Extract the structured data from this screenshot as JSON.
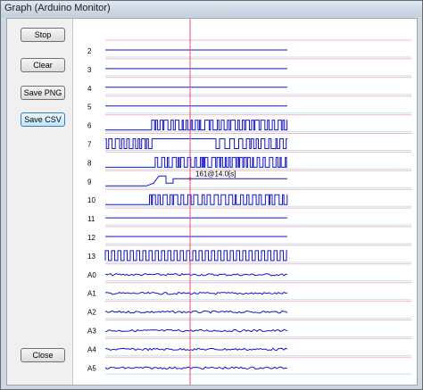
{
  "window": {
    "title": "Graph (Arduino Monitor)"
  },
  "buttons": {
    "stop": "Stop",
    "clear": "Clear",
    "save_png": "Save PNG",
    "save_csv": "Save CSV",
    "close": "Close"
  },
  "colors": {
    "signal": "#1414c8",
    "grid_pink": "#f2b8c6",
    "grid_cyan": "#bfe3ee",
    "cursor": "#e05070"
  },
  "channels": [
    {
      "label": "2",
      "kind": "flat"
    },
    {
      "label": "3",
      "kind": "flat"
    },
    {
      "label": "4",
      "kind": "flat"
    },
    {
      "label": "5",
      "kind": "flat"
    },
    {
      "label": "6",
      "kind": "digital_dense_late"
    },
    {
      "label": "7",
      "kind": "digital_dense_early"
    },
    {
      "label": "8",
      "kind": "digital_dense_late"
    },
    {
      "label": "9",
      "kind": "ramp"
    },
    {
      "label": "10",
      "kind": "digital_dense_late"
    },
    {
      "label": "11",
      "kind": "flat"
    },
    {
      "label": "12",
      "kind": "flat"
    },
    {
      "label": "13",
      "kind": "square"
    },
    {
      "label": "A0",
      "kind": "noise"
    },
    {
      "label": "A1",
      "kind": "noise"
    },
    {
      "label": "A2",
      "kind": "noise"
    },
    {
      "label": "A3",
      "kind": "noise"
    },
    {
      "label": "A4",
      "kind": "noise"
    },
    {
      "label": "A5",
      "kind": "noise"
    }
  ],
  "cursor": {
    "readout": "161@14.0[s]"
  }
}
